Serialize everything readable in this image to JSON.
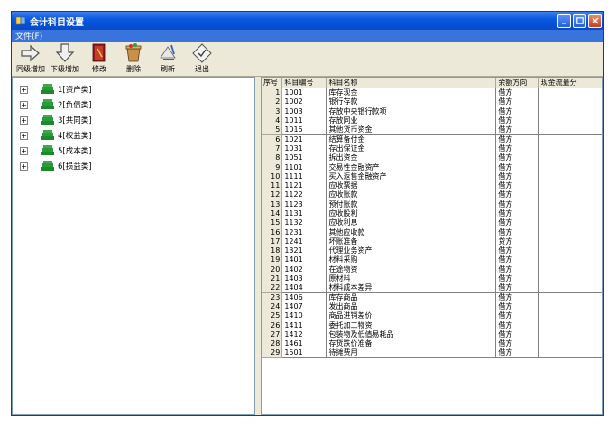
{
  "window": {
    "title": "会计科目设置"
  },
  "menu": {
    "file": "文件(F)"
  },
  "toolbar": [
    {
      "label": "同级增加",
      "icon": "arrow-right-icon"
    },
    {
      "label": "下级增加",
      "icon": "arrow-down-icon"
    },
    {
      "label": "修改",
      "icon": "book-edit-icon"
    },
    {
      "label": "删除",
      "icon": "trash-icon"
    },
    {
      "label": "刷新",
      "icon": "refresh-icon"
    },
    {
      "label": "退出",
      "icon": "exit-icon"
    }
  ],
  "tree": [
    {
      "label": "1[资产类]"
    },
    {
      "label": "2[负债类]"
    },
    {
      "label": "3[共同类]"
    },
    {
      "label": "4[权益类]"
    },
    {
      "label": "5[成本类]"
    },
    {
      "label": "6[损益类]"
    }
  ],
  "grid": {
    "headers": [
      "序号",
      "科目编号",
      "科目名称",
      "余额方向",
      "现金流量分"
    ],
    "rows": [
      [
        "1",
        "1001",
        "库存现金",
        "借方"
      ],
      [
        "2",
        "1002",
        "银行存款",
        "借方"
      ],
      [
        "3",
        "1003",
        "存放中央银行款项",
        "借方"
      ],
      [
        "4",
        "1011",
        "存放同业",
        "借方"
      ],
      [
        "5",
        "1015",
        "其他货币资金",
        "借方"
      ],
      [
        "6",
        "1021",
        "结算备付金",
        "借方"
      ],
      [
        "7",
        "1031",
        "存出保证金",
        "借方"
      ],
      [
        "8",
        "1051",
        "拆出资金",
        "借方"
      ],
      [
        "9",
        "1101",
        "交易性金融资产",
        "借方"
      ],
      [
        "10",
        "1111",
        "买入返售金融资产",
        "借方"
      ],
      [
        "11",
        "1121",
        "应收票据",
        "借方"
      ],
      [
        "12",
        "1122",
        "应收账款",
        "借方"
      ],
      [
        "13",
        "1123",
        "预付账款",
        "借方"
      ],
      [
        "14",
        "1131",
        "应收股利",
        "借方"
      ],
      [
        "15",
        "1132",
        "应收利息",
        "借方"
      ],
      [
        "16",
        "1231",
        "其他应收款",
        "借方"
      ],
      [
        "17",
        "1241",
        "坏账准备",
        "贷方"
      ],
      [
        "18",
        "1321",
        "代理业务资产",
        "借方"
      ],
      [
        "19",
        "1401",
        "材料采购",
        "借方"
      ],
      [
        "20",
        "1402",
        "在途物资",
        "借方"
      ],
      [
        "21",
        "1403",
        "原材料",
        "借方"
      ],
      [
        "22",
        "1404",
        "材料成本差异",
        "借方"
      ],
      [
        "23",
        "1406",
        "库存商品",
        "借方"
      ],
      [
        "24",
        "1407",
        "发出商品",
        "借方"
      ],
      [
        "25",
        "1410",
        "商品进销差价",
        "借方"
      ],
      [
        "26",
        "1411",
        "委托加工物资",
        "借方"
      ],
      [
        "27",
        "1412",
        "包装物及低值易耗品",
        "借方"
      ],
      [
        "28",
        "1461",
        "存货跌价准备",
        "借方"
      ],
      [
        "29",
        "1501",
        "待摊费用",
        "借方"
      ]
    ]
  }
}
